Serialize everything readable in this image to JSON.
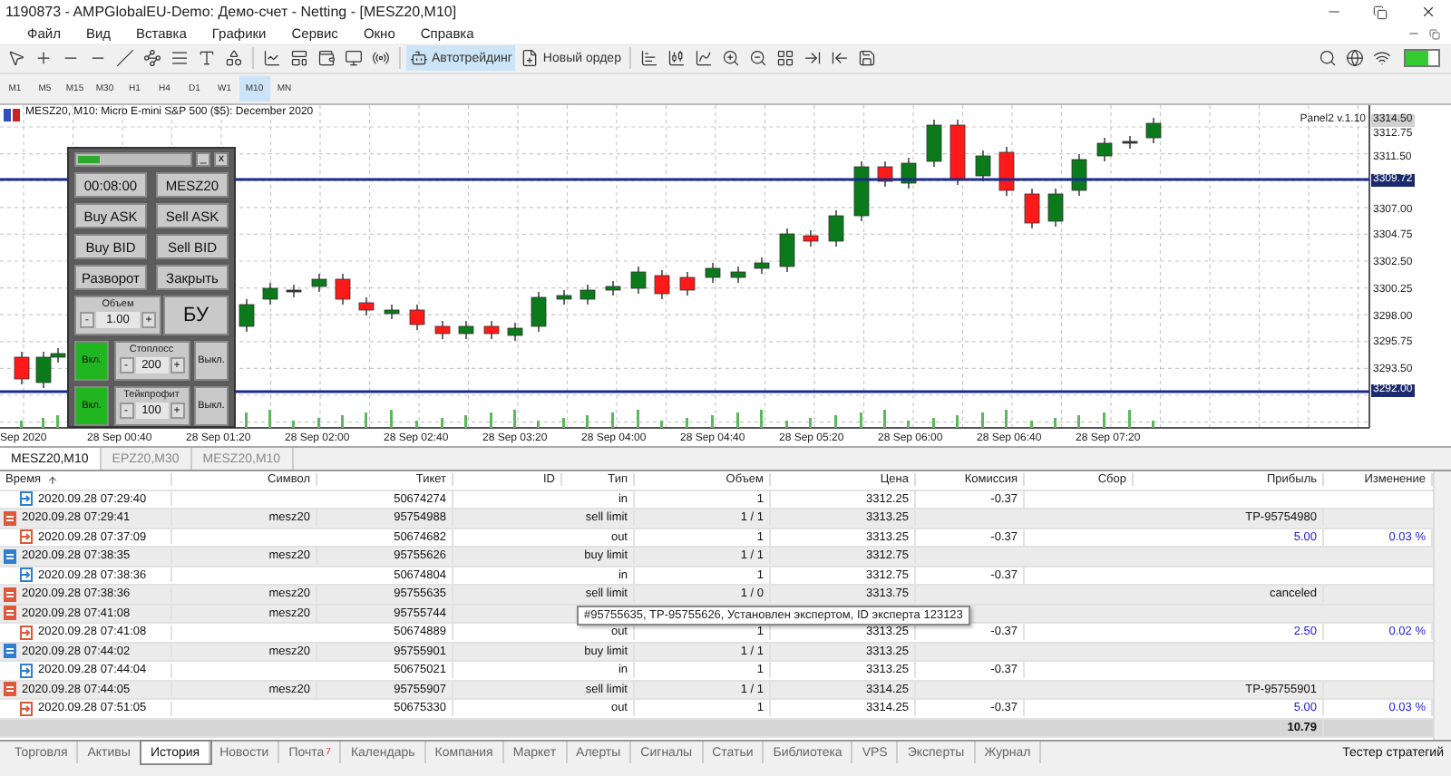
{
  "window": {
    "title": "1190873 - AMPGlobalEU-Demo: Демо-счет - Netting - [MESZ20,M10]"
  },
  "menu": [
    "Файл",
    "Вид",
    "Вставка",
    "Графики",
    "Сервис",
    "Окно",
    "Справка"
  ],
  "toolbar": {
    "autotrading": {
      "label": "Автотрейдинг",
      "on": true
    },
    "new_order": "Новый ордер"
  },
  "timeframes": [
    {
      "label": "M1",
      "selected": false
    },
    {
      "label": "M5",
      "selected": false
    },
    {
      "label": "M15",
      "selected": false
    },
    {
      "label": "M30",
      "selected": false
    },
    {
      "label": "H1",
      "selected": false
    },
    {
      "label": "H4",
      "selected": false
    },
    {
      "label": "D1",
      "selected": false
    },
    {
      "label": "W1",
      "selected": false
    },
    {
      "label": "M10",
      "selected": true
    },
    {
      "label": "MN",
      "selected": false
    }
  ],
  "chart": {
    "title": "MESZ20, M10:  Micro E-mini S&P 500 ($5): December 2020",
    "indicator": "Panel2 v.1.10",
    "price_labels": [
      {
        "text": "3314.50",
        "kind": "current"
      },
      {
        "text": "3312.75",
        "kind": "tick"
      },
      {
        "text": "3311.50",
        "kind": "tick"
      },
      {
        "text": "3309.72",
        "kind": "line"
      },
      {
        "text": "3307.00",
        "kind": "tick"
      },
      {
        "text": "3304.75",
        "kind": "tick"
      },
      {
        "text": "3302.50",
        "kind": "tick"
      },
      {
        "text": "3300.25",
        "kind": "tick"
      },
      {
        "text": "3298.00",
        "kind": "tick"
      },
      {
        "text": "3295.75",
        "kind": "tick"
      },
      {
        "text": "3293.50",
        "kind": "tick"
      },
      {
        "text": "3292.00",
        "kind": "line"
      }
    ],
    "time_labels": [
      "Sep 2020",
      "28 Sep 00:40",
      "28 Sep 01:20",
      "28 Sep 02:00",
      "28 Sep 02:40",
      "28 Sep 03:20",
      "28 Sep 04:00",
      "28 Sep 04:40",
      "28 Sep 05:20",
      "28 Sep 06:00",
      "28 Sep 06:40",
      "28 Sep 07:20"
    ]
  },
  "panel": {
    "controls": [
      "_",
      "x"
    ],
    "time": "00:08:00",
    "symbol": "MESZ20",
    "buttons": [
      "Buy ASK",
      "Sell ASK",
      "Buy BID",
      "Sell BID",
      "Разворот",
      "Закрыть"
    ],
    "volume": {
      "label": "Объем",
      "minus": "-",
      "value": "1.00",
      "plus": "+"
    },
    "breakeven": "БУ",
    "levels": [
      {
        "label": "Стоплосс",
        "on_label": "Вкл.",
        "off_label": "Выкл.",
        "on": true,
        "minus": "-",
        "value": "200",
        "plus": "+"
      },
      {
        "label": "Тейкпрофит",
        "on_label": "Вкл.",
        "off_label": "Выкл.",
        "on": true,
        "minus": "-",
        "value": "100",
        "plus": "+"
      }
    ]
  },
  "chart_tabs": [
    {
      "label": "MESZ20,M10",
      "selected": true
    },
    {
      "label": "EPZ20,M30",
      "selected": false
    },
    {
      "label": "MESZ20,M10",
      "selected": false
    }
  ],
  "table": {
    "columns": [
      "Время",
      "Символ",
      "Тикет",
      "ID",
      "Тип",
      "Объем",
      "Цена",
      "Комиссия",
      "Сбор",
      "Прибыль",
      "Изменение"
    ],
    "rows": [
      {
        "kind": "deal",
        "color": "#2f7fd0",
        "time": "2020.09.28 07:29:40",
        "ticket": "50674274",
        "type": "in",
        "volume": "1",
        "price": "3312.25",
        "commission": "-0.37"
      },
      {
        "kind": "order",
        "color": "#e0583a",
        "time": "2020.09.28 07:29:41",
        "symbol": "mesz20",
        "ticket": "95754988",
        "type": "sell limit",
        "volume": "1 / 1",
        "price": "3313.25",
        "profit": "TP-95754980"
      },
      {
        "kind": "deal",
        "color": "#e0583a",
        "time": "2020.09.28 07:37:09",
        "ticket": "50674682",
        "type": "out",
        "volume": "1",
        "price": "3313.25",
        "commission": "-0.37",
        "profit": "5.00",
        "change": "0.03 %"
      },
      {
        "kind": "order",
        "color": "#2f7fd0",
        "time": "2020.09.28 07:38:35",
        "symbol": "mesz20",
        "ticket": "95755626",
        "type": "buy limit",
        "volume": "1 / 1",
        "price": "3312.75"
      },
      {
        "kind": "deal",
        "color": "#2f7fd0",
        "time": "2020.09.28 07:38:36",
        "ticket": "50674804",
        "type": "in",
        "volume": "1",
        "price": "3312.75",
        "commission": "-0.37"
      },
      {
        "kind": "order",
        "color": "#e0583a",
        "time": "2020.09.28 07:38:36",
        "symbol": "mesz20",
        "ticket": "95755635",
        "type": "sell limit",
        "volume": "1 / 0",
        "price": "3313.75",
        "profit": "canceled"
      },
      {
        "kind": "order",
        "color": "#e0583a",
        "time": "2020.09.28 07:41:08",
        "symbol": "mesz20",
        "ticket": "95755744"
      },
      {
        "kind": "deal",
        "color": "#e0583a",
        "time": "2020.09.28 07:41:08",
        "ticket": "50674889",
        "type": "out",
        "volume": "1",
        "price": "3313.25",
        "commission": "-0.37",
        "profit": "2.50",
        "change": "0.02 %"
      },
      {
        "kind": "order",
        "color": "#2f7fd0",
        "time": "2020.09.28 07:44:02",
        "symbol": "mesz20",
        "ticket": "95755901",
        "type": "buy limit",
        "volume": "1 / 1",
        "price": "3313.25"
      },
      {
        "kind": "deal",
        "color": "#2f7fd0",
        "time": "2020.09.28 07:44:04",
        "ticket": "50675021",
        "type": "in",
        "volume": "1",
        "price": "3313.25",
        "commission": "-0.37"
      },
      {
        "kind": "order",
        "color": "#e0583a",
        "time": "2020.09.28 07:44:05",
        "symbol": "mesz20",
        "ticket": "95755907",
        "type": "sell limit",
        "volume": "1 / 1",
        "price": "3314.25",
        "profit": "TP-95755901"
      },
      {
        "kind": "deal",
        "color": "#e0583a",
        "time": "2020.09.28 07:51:05",
        "ticket": "50675330",
        "type": "out",
        "volume": "1",
        "price": "3314.25",
        "commission": "-0.37",
        "profit": "5.00",
        "change": "0.03 %"
      }
    ],
    "total": "10.79"
  },
  "tooltip": "#95755635, TP-95755626, Установлен экспертом, ID эксперта 123123",
  "bottom_tabs": [
    {
      "label": "Торговля",
      "selected": false
    },
    {
      "label": "Активы",
      "selected": false
    },
    {
      "label": "История",
      "selected": true
    },
    {
      "label": "Новости",
      "selected": false
    },
    {
      "label": "Почта",
      "badge": "7",
      "selected": false
    },
    {
      "label": "Календарь",
      "selected": false
    },
    {
      "label": "Компания",
      "selected": false
    },
    {
      "label": "Маркет",
      "selected": false
    },
    {
      "label": "Алерты",
      "selected": false
    },
    {
      "label": "Сигналы",
      "selected": false
    },
    {
      "label": "Статьи",
      "selected": false
    },
    {
      "label": "Библиотека",
      "selected": false
    },
    {
      "label": "VPS",
      "selected": false
    },
    {
      "label": "Эксперты",
      "selected": false
    },
    {
      "label": "Журнал",
      "selected": false
    }
  ],
  "strategy_tester": "Тестер стратегий"
}
